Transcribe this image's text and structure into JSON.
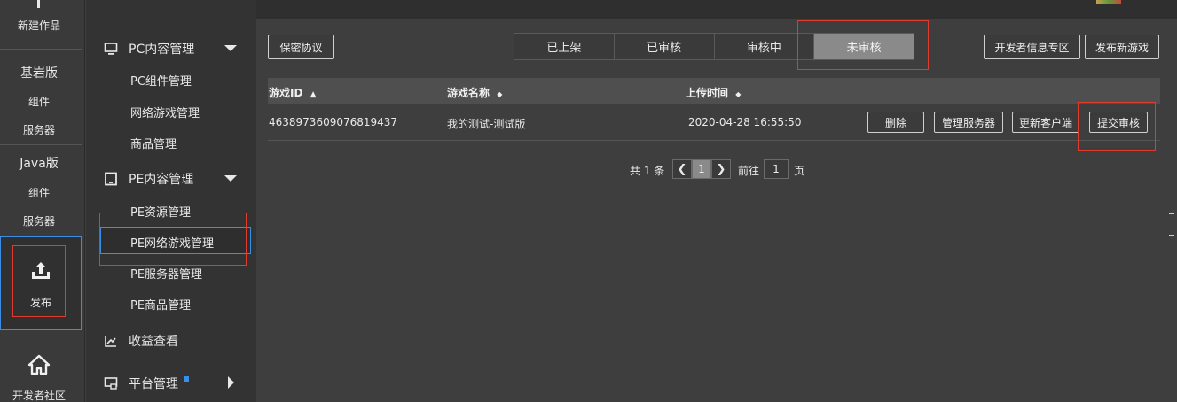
{
  "rail": {
    "new_work": "新建作品",
    "bedrock": "基岩版",
    "bedrock_component": "组件",
    "bedrock_server": "服务器",
    "java": "Java版",
    "java_component": "组件",
    "java_server": "服务器",
    "publish": "发布",
    "community": "开发者社区"
  },
  "sidebar": {
    "pc_group": "PC内容管理",
    "pc_items": [
      "PC组件管理",
      "网络游戏管理",
      "商品管理"
    ],
    "pe_group": "PE内容管理",
    "pe_items": [
      "PE资源管理",
      "PE网络游戏管理",
      "PE服务器管理",
      "PE商品管理"
    ],
    "revenue": "收益查看",
    "platform": "平台管理"
  },
  "toolbar": {
    "agreement": "保密协议",
    "dev_info": "开发者信息专区",
    "publish_new": "发布新游戏"
  },
  "tabs": [
    "已上架",
    "已审核",
    "审核中",
    "未审核"
  ],
  "active_tab": "未审核",
  "table": {
    "headers": [
      "游戏ID",
      "游戏名称",
      "上传时间"
    ],
    "rows": [
      {
        "id": "4638973609076819437",
        "name": "我的测试-测试版",
        "time": "2020-04-28 16:55:50",
        "actions": [
          "删除",
          "管理服务器",
          "更新客户端",
          "提交审核"
        ]
      }
    ]
  },
  "pager": {
    "total": "共 1 条",
    "current": "1",
    "goto_label": "前往",
    "goto_value": "1",
    "page_suffix": "页"
  },
  "colors": {
    "accent": "#3a8ee6",
    "highlight": "#e23b2e"
  }
}
